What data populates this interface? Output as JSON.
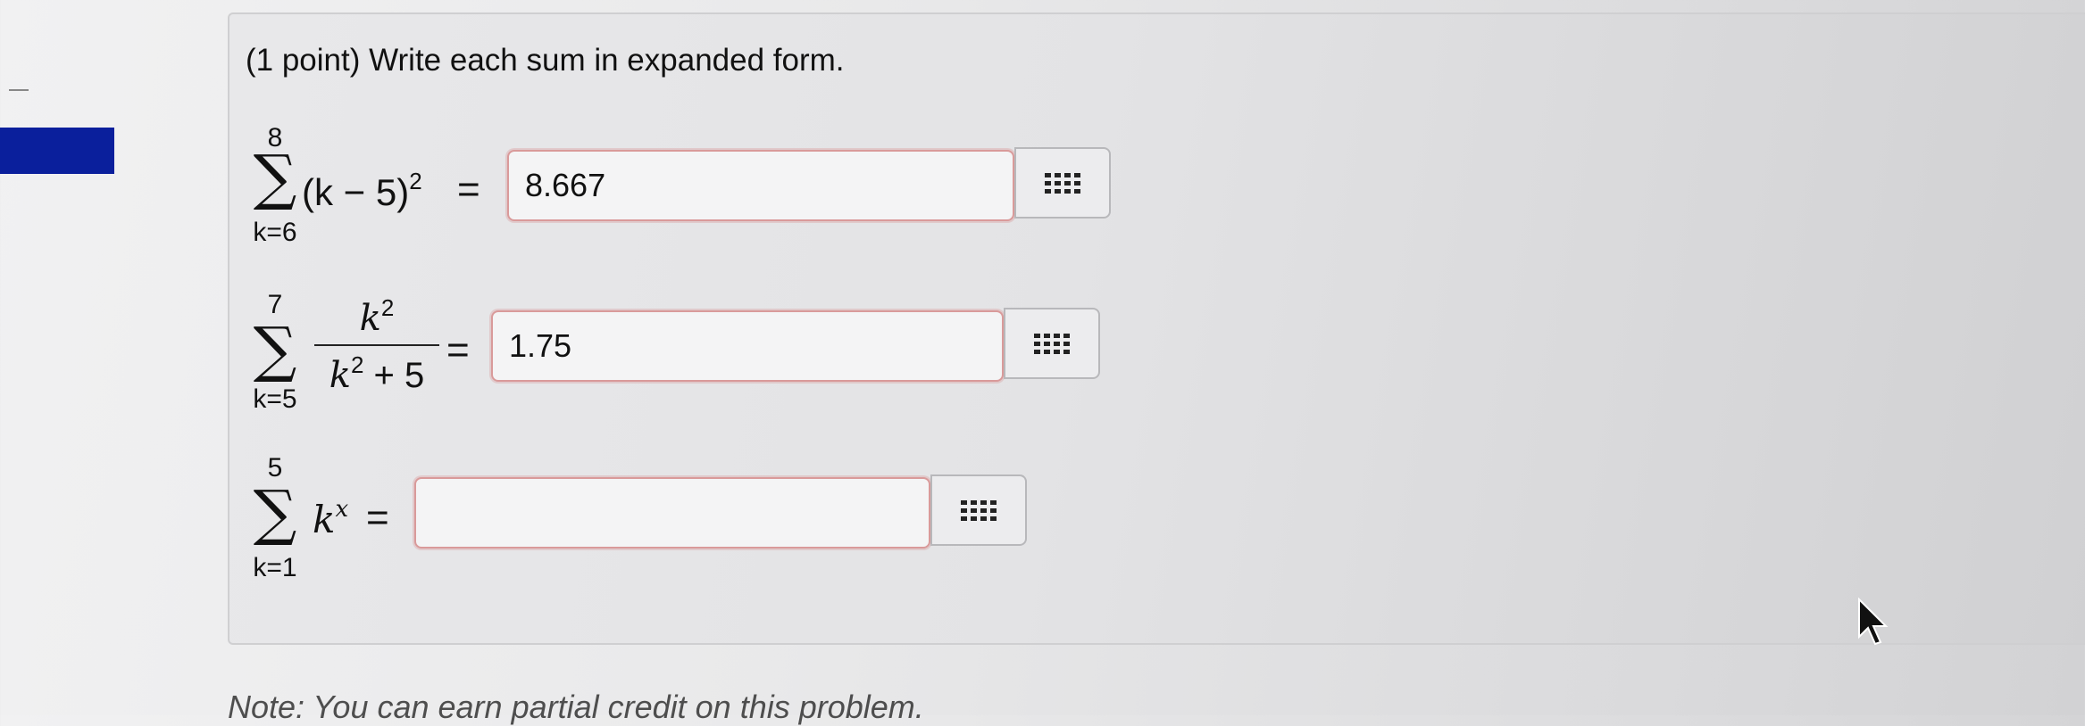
{
  "problem": {
    "prompt": "(1 point) Write each sum in expanded form."
  },
  "sum1": {
    "upper": "8",
    "sigma": "∑",
    "lower": "k=6",
    "expr_text": "(k − 5)",
    "exponent": "2",
    "equals": "=",
    "answer_value": "8.667"
  },
  "sum2": {
    "upper": "7",
    "sigma": "∑",
    "lower": "k=5",
    "numerator_base": "k",
    "numerator_exp": "2",
    "denominator_base": "k",
    "denominator_exp": "2",
    "denominator_rest": " + 5",
    "equals": "=",
    "answer_value": "1.75"
  },
  "sum3": {
    "upper": "5",
    "sigma": "∑",
    "lower": "k=1",
    "base": "k",
    "exponent": "x",
    "equals": "=",
    "answer_value": ""
  },
  "note": {
    "text": "Note: You can earn partial credit on this problem."
  },
  "icons": {
    "equation_palette": "grid-icon",
    "cursor": "mouse-pointer-icon"
  },
  "colors": {
    "sidebar_tab": "#0a1f9c",
    "answer_border": "#d99a9a"
  }
}
